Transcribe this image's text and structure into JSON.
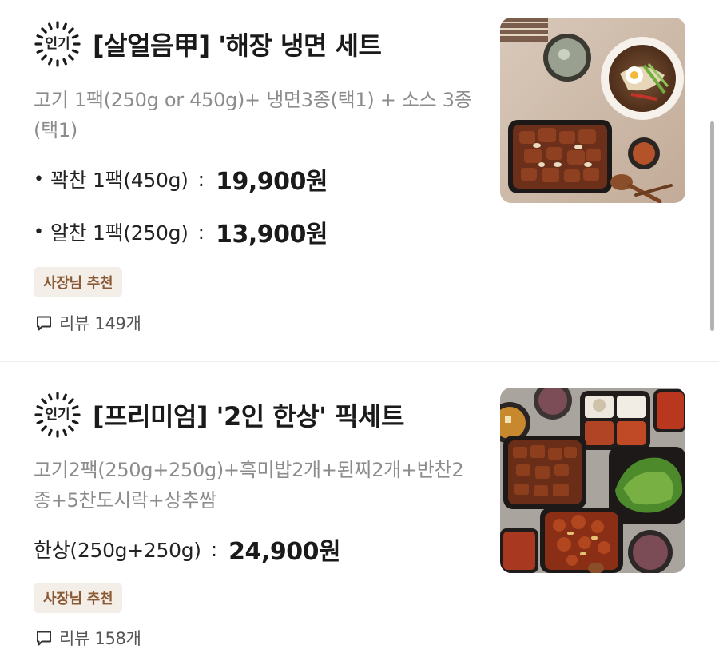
{
  "items": [
    {
      "badge": "인기",
      "name": "[살얼음甲] '해장 냉면 세트",
      "description": "고기 1팩(250g or 450g)+ 냉면3종(택1) + 소스 3종(택1)",
      "options": [
        {
          "bullet": "•",
          "label": "꽉찬 1팩(450g)",
          "separator": ":",
          "price": "19,900원"
        },
        {
          "bullet": "•",
          "label": "알찬 1팩(250g)",
          "separator": ":",
          "price": "13,900원"
        }
      ],
      "tag": "사장님 추천",
      "review": "리뷰 149개"
    },
    {
      "badge": "인기",
      "name": "[프리미엄] '2인 한상' 픽세트",
      "description": "고기2팩(250g+250g)+흑미밥2개+된찌2개+반찬2종+5찬도시락+상추쌈",
      "options": [
        {
          "label": "한상(250g+250g)",
          "separator": ":",
          "price": "24,900원"
        }
      ],
      "tag": "사장님 추천",
      "review": "리뷰 158개"
    }
  ],
  "icons": {
    "badge": "burst-circle-icon",
    "review": "speech-bubble-icon"
  },
  "colors": {
    "tag_background": "#f4eee8",
    "tag_text": "#8a5a35",
    "description_text": "#8c8c8c"
  }
}
